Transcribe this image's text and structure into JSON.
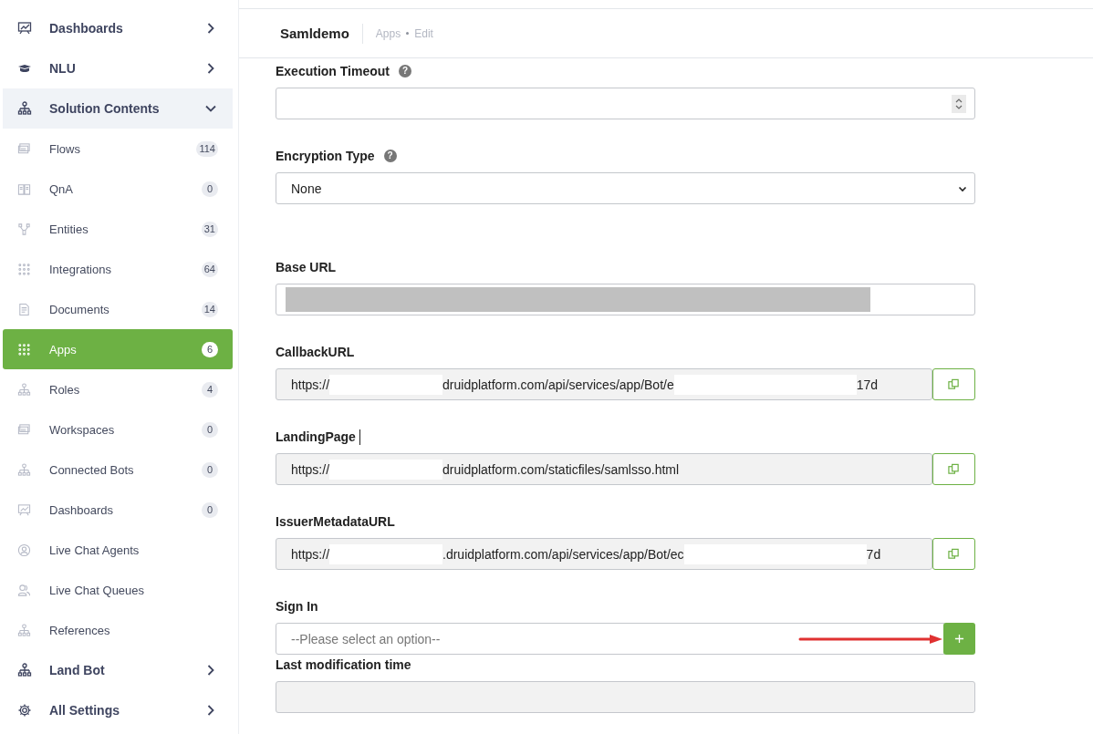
{
  "sidebar": {
    "items": [
      {
        "label": "Dashboards",
        "expanded": false
      },
      {
        "label": "NLU",
        "expanded": false
      },
      {
        "label": "Solution Contents",
        "expanded": true,
        "children": [
          {
            "label": "Flows",
            "count": "114",
            "selected": false
          },
          {
            "label": "QnA",
            "count": "0",
            "selected": false
          },
          {
            "label": "Entities",
            "count": "31",
            "selected": false
          },
          {
            "label": "Integrations",
            "count": "64",
            "selected": false
          },
          {
            "label": "Documents",
            "count": "14",
            "selected": false
          },
          {
            "label": "Apps",
            "count": "6",
            "selected": true
          },
          {
            "label": "Roles",
            "count": "4",
            "selected": false
          },
          {
            "label": "Workspaces",
            "count": "0",
            "selected": false
          },
          {
            "label": "Connected Bots",
            "count": "0",
            "selected": false
          },
          {
            "label": "Dashboards",
            "count": "0",
            "selected": false
          },
          {
            "label": "Live Chat Agents",
            "selected": false
          },
          {
            "label": "Live Chat Queues",
            "selected": false
          },
          {
            "label": "References",
            "selected": false
          }
        ]
      },
      {
        "label": "Land Bot",
        "expanded": false
      },
      {
        "label": "All Settings",
        "expanded": false
      }
    ]
  },
  "header": {
    "title": "Samldemo",
    "breadcrumb": [
      "Apps",
      "Edit"
    ]
  },
  "form": {
    "fields": [
      {
        "kind": "number",
        "label": "Execution Timeout",
        "help": "?"
      },
      {
        "kind": "select",
        "label": "Encryption Type",
        "help": "?",
        "value": "None"
      },
      {
        "kind": "redacted",
        "label": "Base URL"
      },
      {
        "kind": "copy",
        "label": "CallbackURL",
        "parts": [
          {
            "kind": "text",
            "text": "https://"
          },
          {
            "kind": "hidden"
          },
          {
            "kind": "text",
            "text": "druidplatform.com/api/services/app/Bot/e"
          },
          {
            "kind": "hidden"
          },
          {
            "kind": "text",
            "text": "17d"
          }
        ]
      },
      {
        "kind": "copy",
        "label": "LandingPage",
        "cursor": true,
        "parts": [
          {
            "kind": "text",
            "text": "https://"
          },
          {
            "kind": "hidden"
          },
          {
            "kind": "text",
            "text": "druidplatform.com/staticfiles/samlsso.html"
          }
        ]
      },
      {
        "kind": "copy",
        "label": "IssuerMetadataURL",
        "parts": [
          {
            "kind": "text",
            "text": "https://"
          },
          {
            "kind": "hidden"
          },
          {
            "kind": "text",
            "text": ".druidplatform.com/api/services/app/Bot/ec"
          },
          {
            "kind": "hidden"
          },
          {
            "kind": "text",
            "text": "7d"
          }
        ]
      },
      {
        "kind": "select-add",
        "label": "Sign In",
        "placeholder": "--Please select an option--",
        "arrow": true
      },
      {
        "kind": "readonly",
        "label": "Last modification time"
      }
    ]
  }
}
